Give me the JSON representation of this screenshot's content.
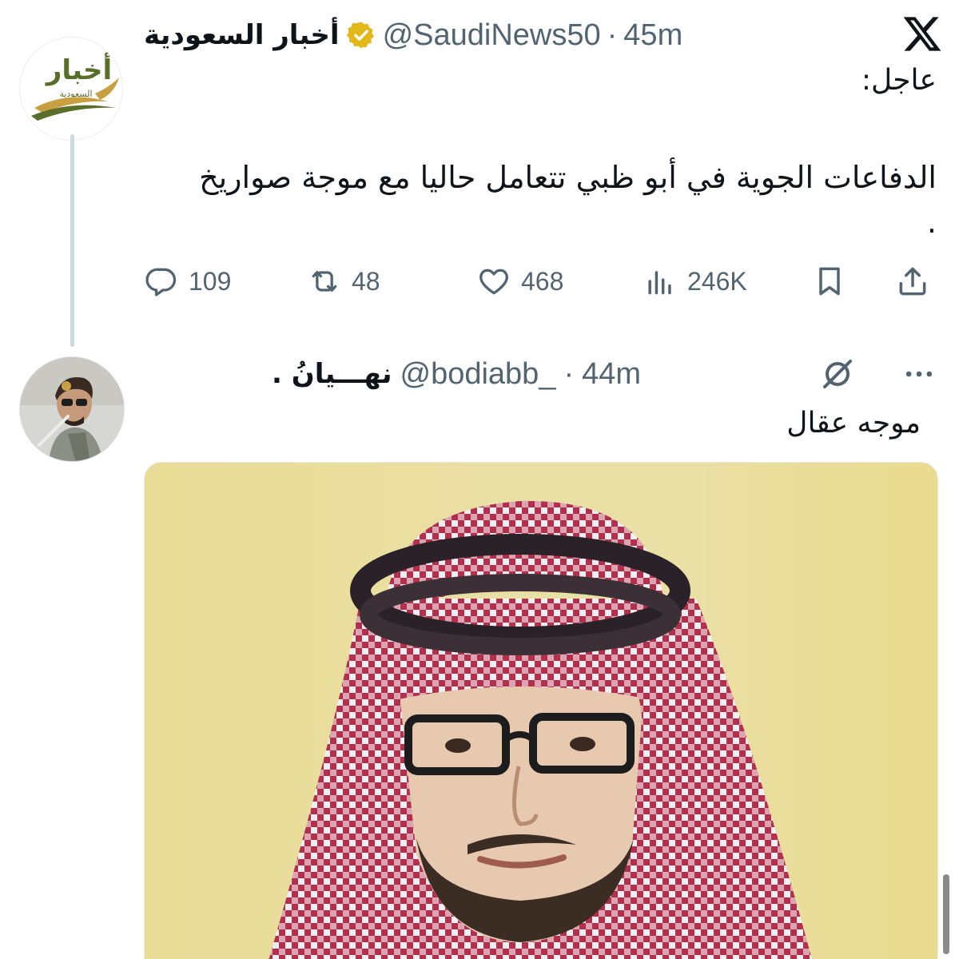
{
  "tweet1": {
    "account_name": "أخبار السعودية",
    "handle": "@SaudiNews50",
    "separator": "·",
    "time": "45m",
    "avatar_logo_main": "أخبار",
    "avatar_logo_sub": "السعودية",
    "label": "عاجل:",
    "body": "الدفاعات الجوية في أبو ظبي تتعامل حاليا مع موجة صواريخ",
    "body_end": ".",
    "verified": true,
    "actions": {
      "replies": "109",
      "reposts": "48",
      "likes": "468",
      "views": "246K"
    }
  },
  "tweet2": {
    "account_name": "نهـــيانُ .",
    "handle": "@bodiabb_",
    "separator": "·",
    "time": "44m",
    "body": "موجه عقال"
  },
  "icons": {
    "x_logo": "x-logo-icon",
    "verified": "verified-badge-icon",
    "reply": "reply-icon",
    "repost": "repost-icon",
    "like": "heart-icon",
    "views": "views-icon",
    "bookmark": "bookmark-icon",
    "share": "share-icon",
    "grok": "grok-icon",
    "more": "more-icon"
  },
  "colors": {
    "text_primary": "#0f1419",
    "text_secondary": "#536471",
    "verified_gold": "#e2b719",
    "logo_green": "#5a6e2a",
    "logo_gold": "#c8a042"
  }
}
